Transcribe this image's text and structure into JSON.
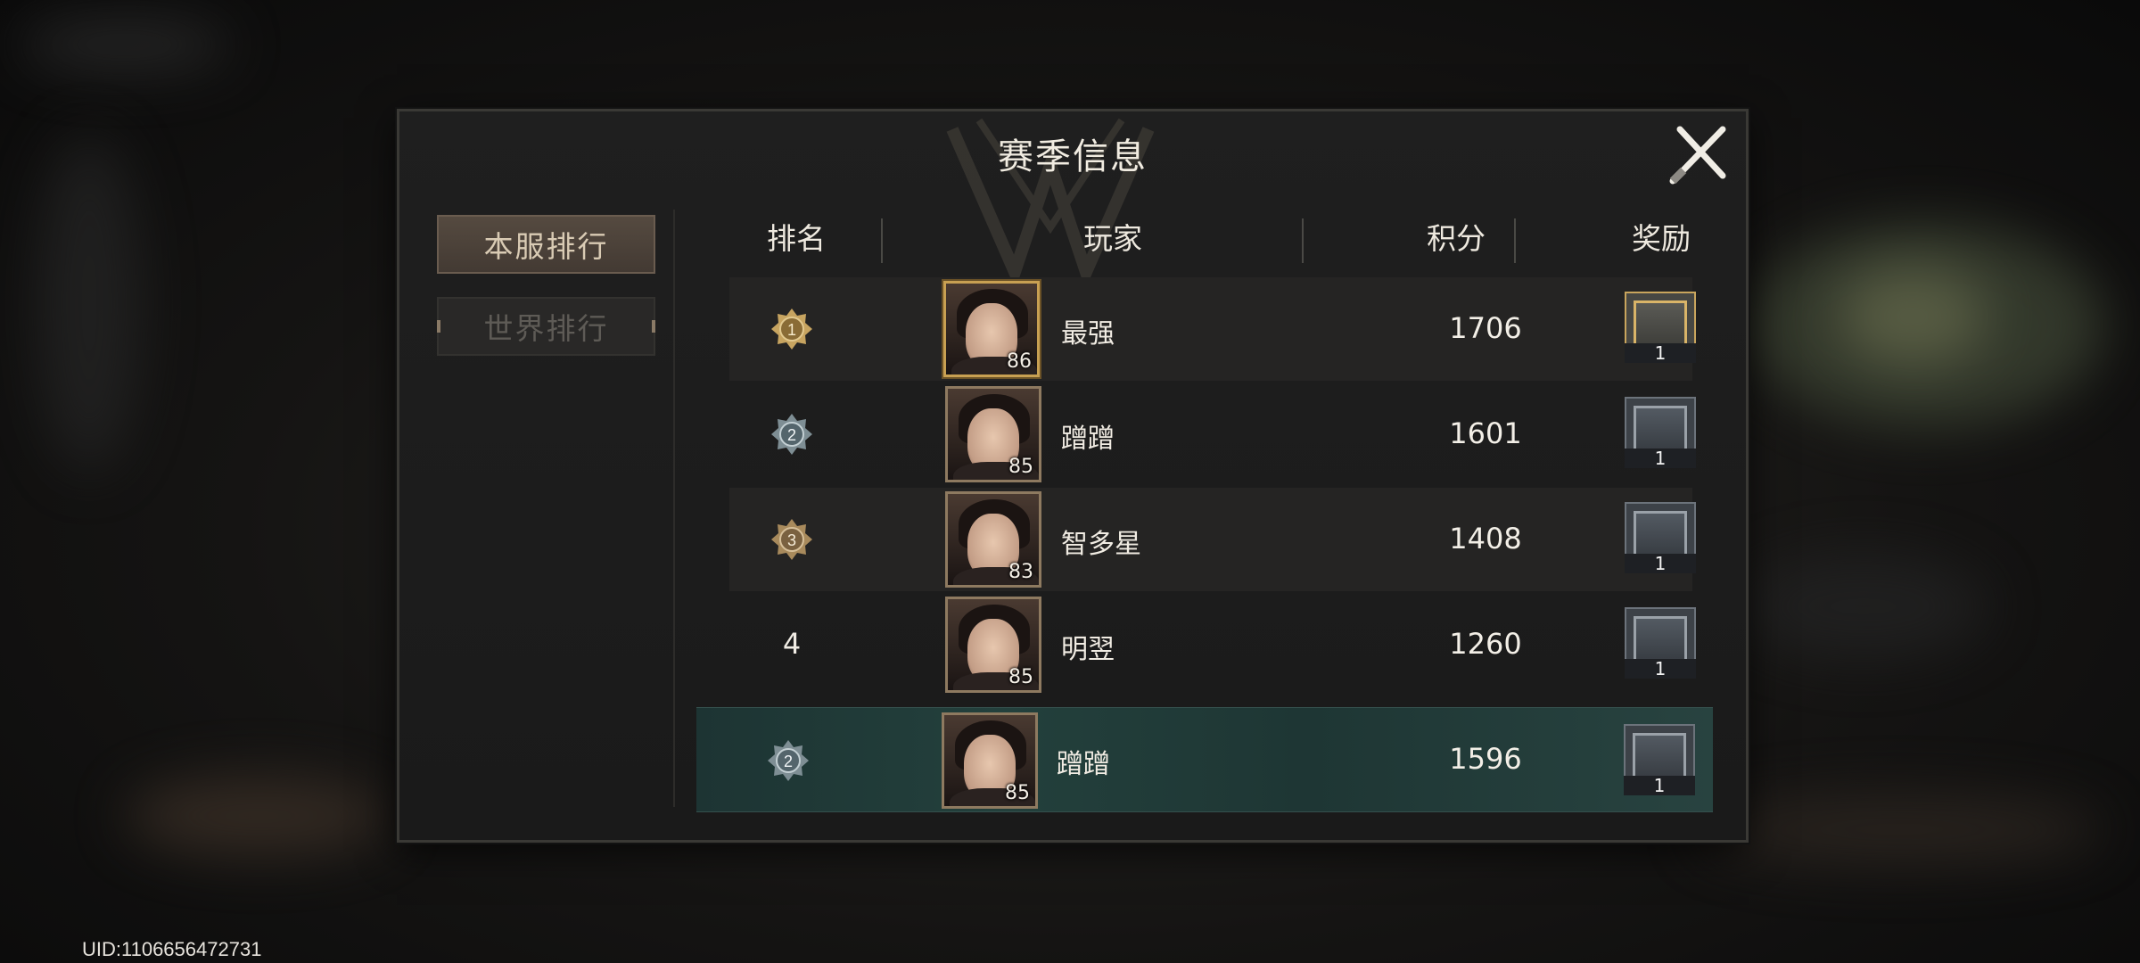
{
  "window": {
    "title": "赛季信息"
  },
  "tabs": [
    {
      "label": "本服排行",
      "active": true
    },
    {
      "label": "世界排行",
      "active": false
    }
  ],
  "table": {
    "headers": {
      "rank": "排名",
      "player": "玩家",
      "score": "积分",
      "reward": "奖励"
    },
    "rows": [
      {
        "rank": "1",
        "name": "最强",
        "level": "86",
        "score": "1706",
        "reward_count": "1",
        "reward_tier": "gold"
      },
      {
        "rank": "2",
        "name": "蹭蹭",
        "level": "85",
        "score": "1601",
        "reward_count": "1",
        "reward_tier": "silver"
      },
      {
        "rank": "3",
        "name": "智多星",
        "level": "83",
        "score": "1408",
        "reward_count": "1",
        "reward_tier": "silver"
      },
      {
        "rank": "4",
        "name": "明翌",
        "level": "85",
        "score": "1260",
        "reward_count": "1",
        "reward_tier": "silver"
      }
    ],
    "my_row": {
      "rank": "2",
      "name": "蹭蹭",
      "level": "85",
      "score": "1596",
      "reward_count": "1",
      "reward_tier": "silver"
    }
  },
  "footer": {
    "uid": "UID:1106656472731"
  },
  "colors": {
    "gold_medal": "#c7a460",
    "silver_medal": "#7e8e94",
    "bronze_medal": "#a88a5c",
    "my_row_bg": "#23403c",
    "active_tab": "#4b4139"
  }
}
